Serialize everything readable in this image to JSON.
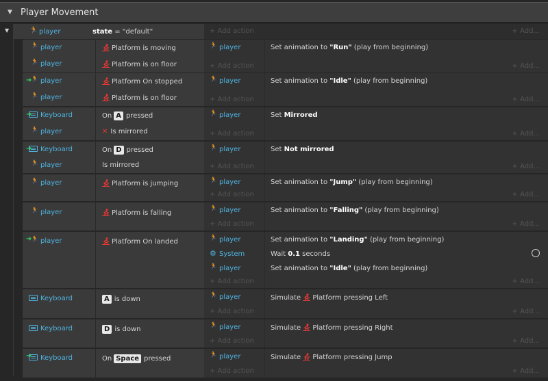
{
  "group": {
    "title": "Player Movement"
  },
  "main_event": {
    "object": "player",
    "condition_prefix": "state",
    "condition_value": " = \"default\"",
    "add_action": "+ Add action",
    "add": "+ Add..."
  },
  "common": {
    "add_action": "+ Add action",
    "add": "+ Add..."
  },
  "events": [
    {
      "conds": [
        {
          "obj": "player",
          "text": "Platform is moving"
        },
        {
          "obj": "player",
          "text": "Platform is on floor"
        }
      ],
      "acts": [
        {
          "obj": "player",
          "pre": "Set animation to ",
          "bold": "\"Run\"",
          "post": " (play from beginning)"
        }
      ]
    },
    {
      "conds": [
        {
          "obj": "player",
          "text": "Platform On stopped"
        },
        {
          "obj": "player",
          "text": "Platform is on floor"
        }
      ],
      "acts": [
        {
          "obj": "player",
          "pre": "Set animation to ",
          "bold": "\"Idle\"",
          "post": " (play from beginning)"
        }
      ]
    },
    {
      "conds": [
        {
          "obj": "Keyboard",
          "pre": "On",
          "key": "A",
          "post": "pressed"
        },
        {
          "obj": "player",
          "text": "Is mirrored"
        }
      ],
      "acts": [
        {
          "obj": "player",
          "pre": "Set ",
          "bold": "Mirrored",
          "post": ""
        }
      ]
    },
    {
      "conds": [
        {
          "obj": "Keyboard",
          "pre": "On",
          "key": "D",
          "post": "pressed"
        },
        {
          "obj": "player",
          "text": "Is mirrored"
        }
      ],
      "acts": [
        {
          "obj": "player",
          "pre": "Set ",
          "bold": "Not mirrored",
          "post": ""
        }
      ]
    },
    {
      "conds": [
        {
          "obj": "player",
          "text": "Platform is jumping"
        }
      ],
      "acts": [
        {
          "obj": "player",
          "pre": "Set animation to ",
          "bold": "\"Jump\"",
          "post": " (play from beginning)"
        }
      ]
    },
    {
      "conds": [
        {
          "obj": "player",
          "text": "Platform is falling"
        }
      ],
      "acts": [
        {
          "obj": "player",
          "pre": "Set animation to ",
          "bold": "\"Falling\"",
          "post": " (play from beginning)"
        }
      ]
    },
    {
      "conds": [
        {
          "obj": "player",
          "text": "Platform On landed"
        }
      ],
      "acts": [
        {
          "obj": "player",
          "pre": "Set animation to ",
          "bold": "\"Landing\"",
          "post": " (play from beginning)"
        },
        {
          "obj": "System",
          "pre": "Wait ",
          "bold": "0.1",
          "post": " seconds"
        },
        {
          "obj": "player",
          "pre": "Set animation to ",
          "bold": "\"Idle\"",
          "post": " (play from beginning)"
        }
      ]
    },
    {
      "conds": [
        {
          "obj": "Keyboard",
          "key": "A",
          "post": "is down"
        }
      ],
      "acts": [
        {
          "obj": "player",
          "pre": "Simulate ",
          "plat": "Platform pressing Left"
        }
      ]
    },
    {
      "conds": [
        {
          "obj": "Keyboard",
          "key": "D",
          "post": "is down"
        }
      ],
      "acts": [
        {
          "obj": "player",
          "pre": "Simulate ",
          "plat": "Platform pressing Right"
        }
      ]
    },
    {
      "conds": [
        {
          "obj": "Keyboard",
          "pre": "On",
          "key": "Space",
          "post": "pressed"
        }
      ],
      "acts": [
        {
          "obj": "player",
          "pre": "Simulate ",
          "plat": "Platform pressing Jump"
        }
      ]
    }
  ]
}
